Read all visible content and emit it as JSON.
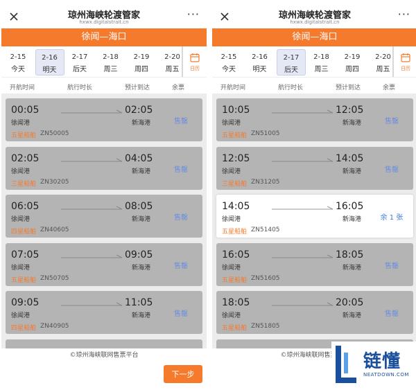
{
  "screens": [
    {
      "header": {
        "title": "琼州海峡轮渡管家",
        "subtitle": "hxwx.digitalstrait.cn",
        "more": "···"
      },
      "route": "徐闻—海口",
      "dates": [
        {
          "date": "2-15",
          "day": "今天"
        },
        {
          "date": "2-16",
          "day": "明天"
        },
        {
          "date": "2-17",
          "day": "后天"
        },
        {
          "date": "2-18",
          "day": "周三"
        },
        {
          "date": "2-19",
          "day": "周四"
        },
        {
          "date": "2-20",
          "day": "周五"
        }
      ],
      "selected_date_index": 1,
      "calendar_label": "日历",
      "columns": {
        "depart": "开航时间",
        "duration": "航行时长",
        "arrive": "预计到达",
        "remaining": "余票"
      },
      "trips": [
        {
          "dep": "00:05",
          "arr": "02:05",
          "from": "徐闻港",
          "to": "新海港",
          "ship": "五星船舶",
          "code": "ZN50005",
          "status": "售罄",
          "available": false
        },
        {
          "dep": "02:05",
          "arr": "04:05",
          "from": "徐闻港",
          "to": "新海港",
          "ship": "三星船舶",
          "code": "ZN30205",
          "status": "售罄",
          "available": false
        },
        {
          "dep": "06:05",
          "arr": "08:05",
          "from": "徐闻港",
          "to": "新海港",
          "ship": "四星船舶",
          "code": "ZN40605",
          "status": "售罄",
          "available": false
        },
        {
          "dep": "07:05",
          "arr": "09:05",
          "from": "徐闻港",
          "to": "新海港",
          "ship": "五星船舶",
          "code": "ZN50705",
          "status": "售罄",
          "available": false
        },
        {
          "dep": "09:05",
          "arr": "11:05",
          "from": "徐闻港",
          "to": "新海港",
          "ship": "四星船舶",
          "code": "ZN40905",
          "status": "售罄",
          "available": false
        }
      ],
      "footer": "©琼州海峡联网售票平台",
      "next_button": "下一步"
    },
    {
      "header": {
        "title": "琼州海峡轮渡管家",
        "subtitle": "hxwx.digitalstrait.cn",
        "more": "···"
      },
      "route": "徐闻—海口",
      "dates": [
        {
          "date": "2-15",
          "day": "今天"
        },
        {
          "date": "2-16",
          "day": "明天"
        },
        {
          "date": "2-17",
          "day": "后天"
        },
        {
          "date": "2-18",
          "day": "周三"
        },
        {
          "date": "2-19",
          "day": "周四"
        },
        {
          "date": "2-20",
          "day": "周五"
        }
      ],
      "selected_date_index": 2,
      "calendar_label": "日历",
      "columns": {
        "depart": "开航时间",
        "duration": "航行时长",
        "arrive": "预计到达",
        "remaining": "余票"
      },
      "trips": [
        {
          "dep": "10:05",
          "arr": "12:05",
          "from": "徐闻港",
          "to": "新海港",
          "ship": "五星船舶",
          "code": "ZN51005",
          "status": "售罄",
          "available": false
        },
        {
          "dep": "12:05",
          "arr": "14:05",
          "from": "徐闻港",
          "to": "新海港",
          "ship": "三星船舶",
          "code": "ZN31205",
          "status": "售罄",
          "available": false
        },
        {
          "dep": "14:05",
          "arr": "16:05",
          "from": "徐闻港",
          "to": "新海港",
          "ship": "五星船舶",
          "code": "ZN51405",
          "status": "余 1 张",
          "available": true
        },
        {
          "dep": "16:05",
          "arr": "18:05",
          "from": "徐闻港",
          "to": "新海港",
          "ship": "五星船舶",
          "code": "ZN51605",
          "status": "售罄",
          "available": false
        },
        {
          "dep": "18:05",
          "arr": "20:05",
          "from": "徐闻港",
          "to": "新海港",
          "ship": "五星船舶",
          "code": "ZN51805",
          "status": "售罄",
          "available": false
        }
      ],
      "footer": "©琼州海峡联网售票平台",
      "next_button": ""
    }
  ],
  "watermark": {
    "text": "链懂",
    "subtitle": "NEATDOWN.COM"
  },
  "colors": {
    "brand_orange": "#f57a2c",
    "sold_out_card": "#b4b4b4",
    "available_text": "#3d7be0",
    "logo_blue": "#1a4f9e"
  }
}
